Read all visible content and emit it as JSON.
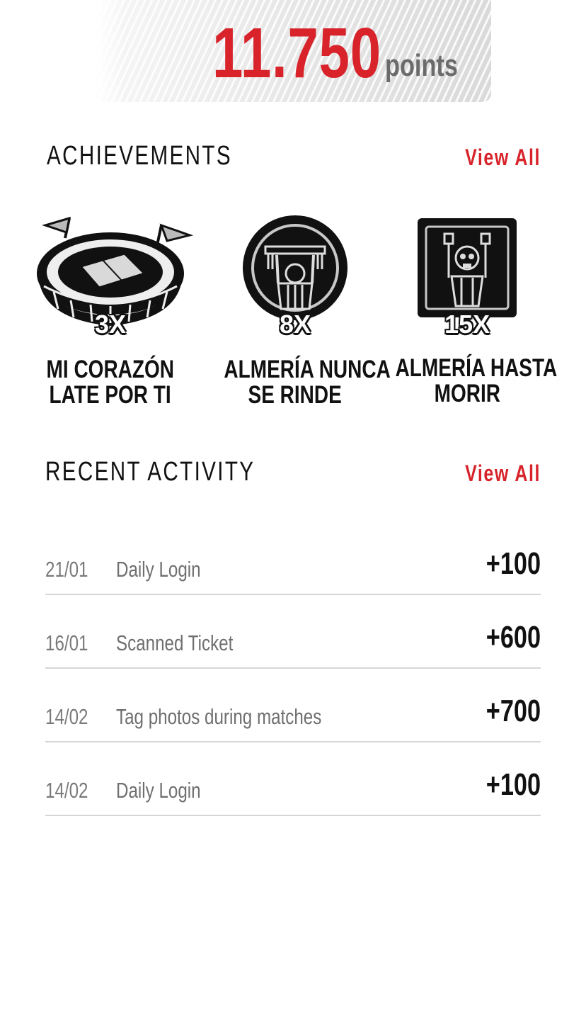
{
  "points": {
    "value": "11.750",
    "label": "points"
  },
  "achievements": {
    "title": "ACHIEVEMENTS",
    "view_all": "View All",
    "items": [
      {
        "count": "3X",
        "title_line1": "MI CORAZÓN",
        "title_line2": "LATE POR TI",
        "icon": "stadium-icon"
      },
      {
        "count": "8X",
        "title_line1": "ALMERÍA NUNCA",
        "title_line2": "SE RINDE",
        "icon": "fan-with-scarf-icon"
      },
      {
        "count": "15X",
        "title_line1": "ALMERÍA HASTA",
        "title_line2": "MORIR",
        "icon": "skeleton-fan-icon"
      }
    ]
  },
  "activity": {
    "title": "RECENT ACTIVITY",
    "view_all": "View All",
    "rows": [
      {
        "date": "21/01",
        "description": "Daily Login",
        "points": "+100"
      },
      {
        "date": "16/01",
        "description": "Scanned Ticket",
        "points": "+600"
      },
      {
        "date": "14/02",
        "description": "Tag photos during matches",
        "points": "+700"
      },
      {
        "date": "14/02",
        "description": "Daily Login",
        "points": "+100"
      }
    ]
  },
  "colors": {
    "accent": "#d8232a",
    "text": "#111111",
    "muted": "#7a7a7a",
    "divider": "#d6d6d6"
  }
}
